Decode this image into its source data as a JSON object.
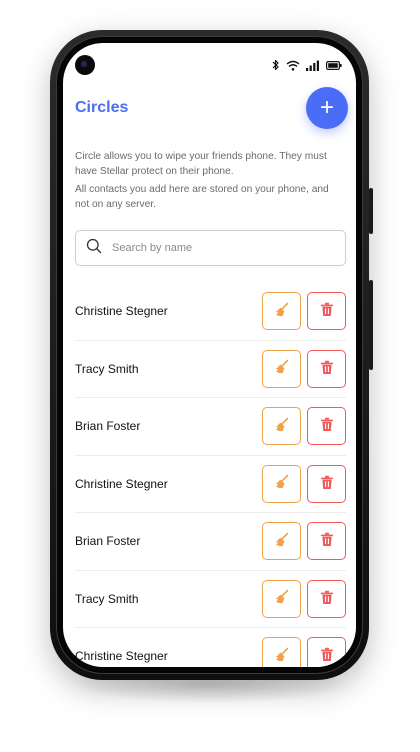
{
  "header": {
    "title": "Circles",
    "add_button_label": "+"
  },
  "description": {
    "paragraph1": "Circle allows you to wipe your friends phone. They must have Stellar protect on their phone.",
    "paragraph2": "All contacts you add here are stored on your phone, and not on any server."
  },
  "search": {
    "placeholder": "Search by name",
    "value": ""
  },
  "contacts": [
    {
      "name": "Christine Stegner"
    },
    {
      "name": "Tracy Smith"
    },
    {
      "name": "Brian Foster"
    },
    {
      "name": "Christine Stegner"
    },
    {
      "name": "Brian Foster"
    },
    {
      "name": "Tracy Smith"
    },
    {
      "name": "Christine Stegner"
    }
  ],
  "icons": {
    "status": [
      "bluetooth-icon",
      "wifi-icon",
      "signal-icon",
      "battery-icon"
    ],
    "search": "search-icon",
    "add": "plus-icon",
    "wipe": "broom-icon",
    "delete": "trash-icon"
  },
  "colors": {
    "accent": "#4a6cf7",
    "wipe": "#f0a24a",
    "delete": "#ef5b5b"
  }
}
